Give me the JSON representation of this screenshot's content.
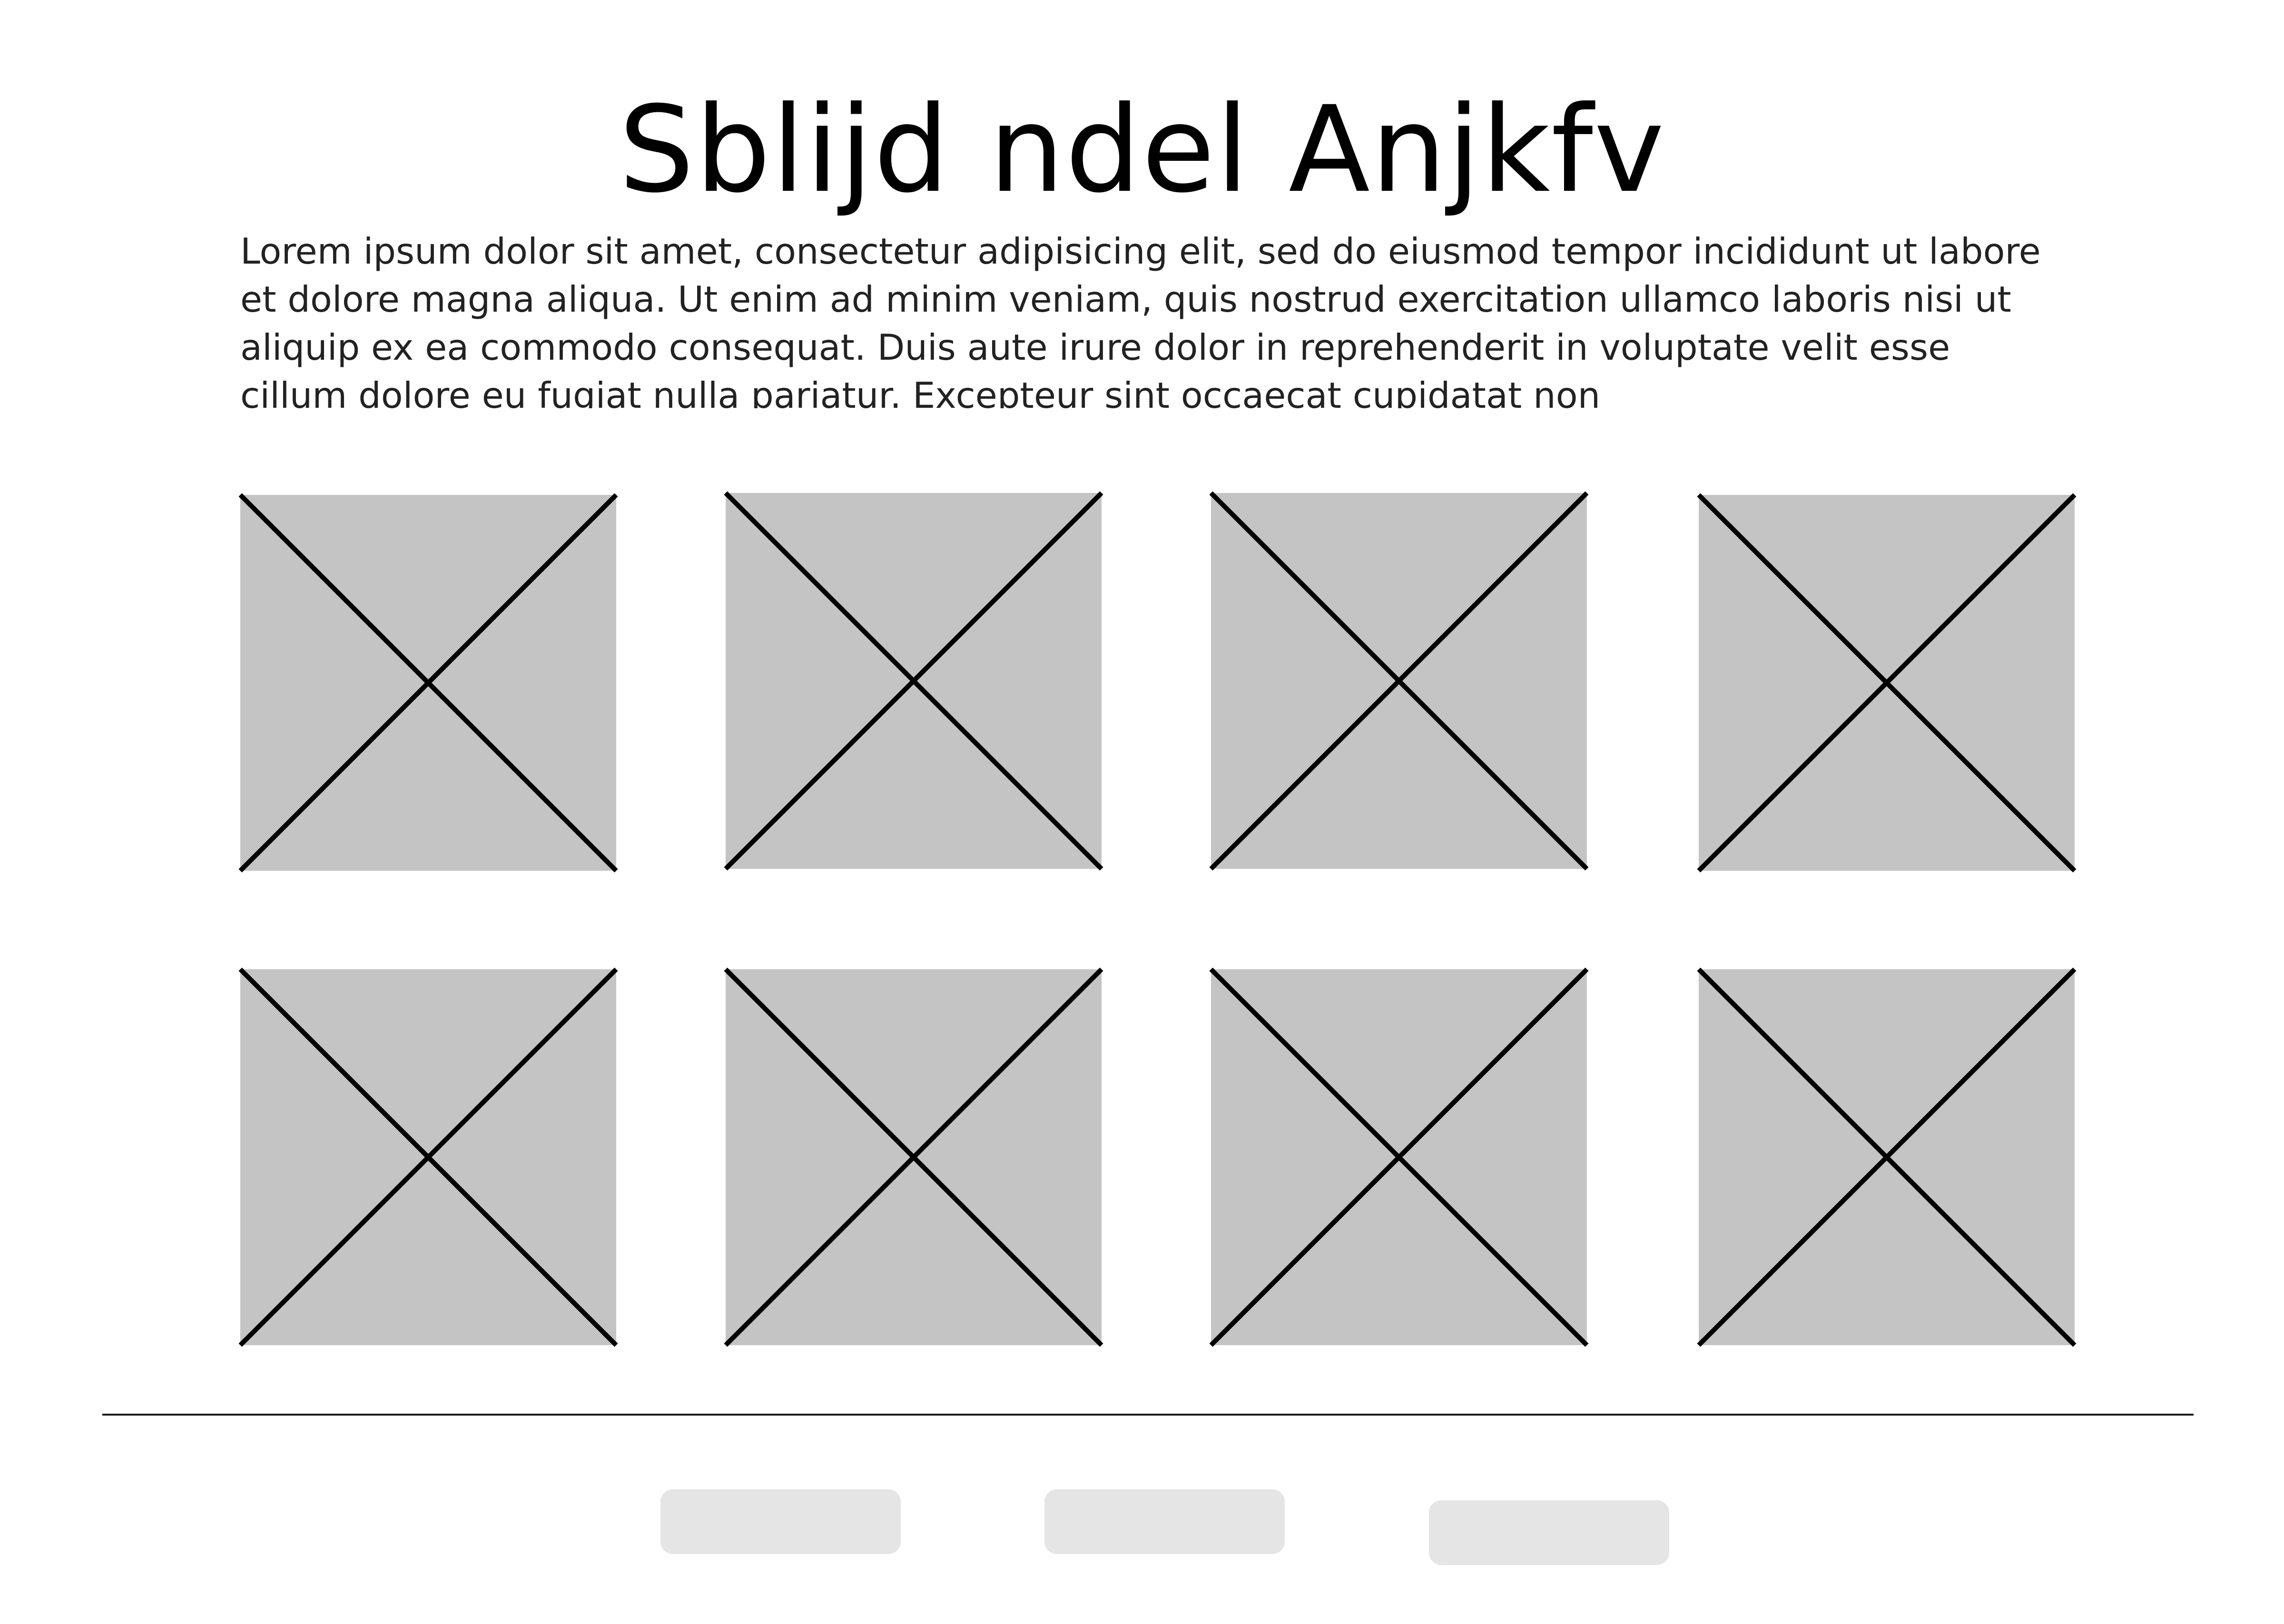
{
  "page": {
    "title": "Sblijd ndel Anjkfv",
    "intro": "Lorem ipsum dolor sit amet, consectetur adipisicing elit, sed do eiusmod tempor incididunt ut labore et dolore magna aliqua. Ut enim ad minim veniam, quis nostrud exercitation ullamco laboris nisi ut aliquip ex ea commodo consequat. Duis aute irure dolor in reprehenderit in voluptate velit esse cillum dolore eu fugiat nulla pariatur. Excepteur sint occaecat cupidatat non"
  },
  "gallery": {
    "placeholder_icon": "image-placeholder-icon",
    "tile_color": "#c4c4c4",
    "tile_count": 8
  },
  "footer": {
    "button_color": "#e5e5e5",
    "buttons": [
      "",
      "",
      ""
    ]
  }
}
